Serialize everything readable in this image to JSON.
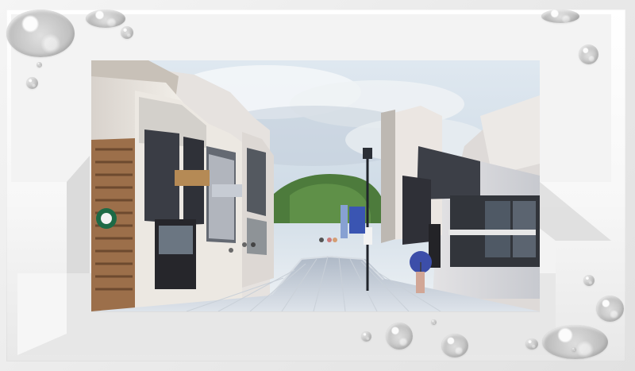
{
  "app": {
    "title": ""
  },
  "photo": {
    "description": "",
    "sign_text": ""
  },
  "decorations": {
    "drop_icon": "water-drop-icon",
    "accent_color": "#cfcfcf"
  }
}
